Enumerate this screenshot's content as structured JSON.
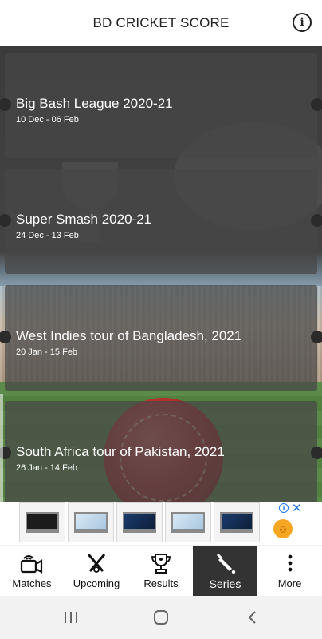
{
  "header": {
    "title": "BD CRICKET SCORE",
    "info_icon": "info-circle-icon"
  },
  "series": [
    {
      "title": "Big Bash League 2020-21",
      "dates": "10 Dec - 06 Feb"
    },
    {
      "title": "Super Smash 2020-21",
      "dates": "24 Dec - 13 Feb"
    },
    {
      "title": "West Indies tour of Bangladesh, 2021",
      "dates": "20 Jan - 15 Feb"
    },
    {
      "title": "South Africa tour of Pakistan, 2021",
      "dates": "26 Jan - 14 Feb"
    }
  ],
  "ad": {
    "thumbnails": [
      "laptop",
      "laptop",
      "laptop",
      "laptop",
      "laptop"
    ],
    "info_icon": "ad-info-icon",
    "close_icon": "ad-close-icon",
    "info_glyph": "i",
    "close_glyph": "✕"
  },
  "bottom_nav": {
    "active": "Series",
    "items": [
      {
        "label": "Matches",
        "icon": "video-camera-icon"
      },
      {
        "label": "Upcoming",
        "icon": "crossed-bats-icon"
      },
      {
        "label": "Results",
        "icon": "trophy-icon"
      },
      {
        "label": "Series",
        "icon": "cricket-bat-icon"
      },
      {
        "label": "More",
        "icon": "more-vertical-icon"
      }
    ]
  },
  "system_nav": [
    "recent-apps-icon",
    "home-icon",
    "back-icon"
  ],
  "colors": {
    "card_overlay": "#464646",
    "active_tab": "#333333",
    "ad_accent": "#1a73e8"
  }
}
